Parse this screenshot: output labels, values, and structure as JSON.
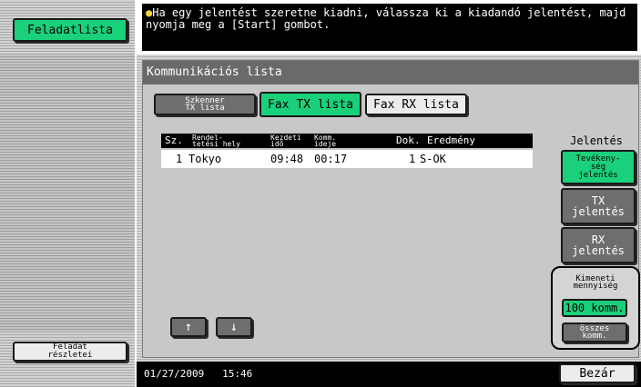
{
  "sidebar": {
    "task_list_label": "Feladatlista",
    "task_details_label": "Feladat\nrészletei"
  },
  "message": {
    "text": "Ha egy jelentést szeretne kiadni, válassza ki a kiadandó jelentést, majd nyomja meg a [Start] gombot."
  },
  "panel": {
    "title": "Kommunikációs lista"
  },
  "tabs": [
    {
      "label": "Szkenner\nTX lista",
      "selected": false
    },
    {
      "label": "Fax TX lista",
      "selected": true
    },
    {
      "label": "Fax RX lista",
      "selected": false
    }
  ],
  "table": {
    "columns": [
      "Sz.",
      "Rendel-\ntetési hely",
      "Kezdeti\nidő",
      "Komm.\nideje",
      "Dok.",
      "Eredmény"
    ],
    "rows": [
      {
        "no": "1",
        "destination": "Tokyo",
        "start": "09:48",
        "duration": "00:17",
        "docs": "1",
        "result": "S-OK"
      }
    ]
  },
  "scroll": {
    "up_symbol": "↑",
    "down_symbol": "↓"
  },
  "reports": {
    "header": "Jelentés",
    "activity": "Tevékeny-\nség\njelentés",
    "tx": "TX\njelentés",
    "rx": "RX\njelentés"
  },
  "quantity": {
    "label": "Kimeneti\nmennyiség",
    "option_100": "100 komm.",
    "option_all": "összes\nkomm."
  },
  "status": {
    "datetime": "01/27/2009   15:46"
  },
  "footer": {
    "close_label": "Bezár"
  },
  "colors": {
    "accent_green": "#1ad07a",
    "bulb": "#f5d23a"
  }
}
